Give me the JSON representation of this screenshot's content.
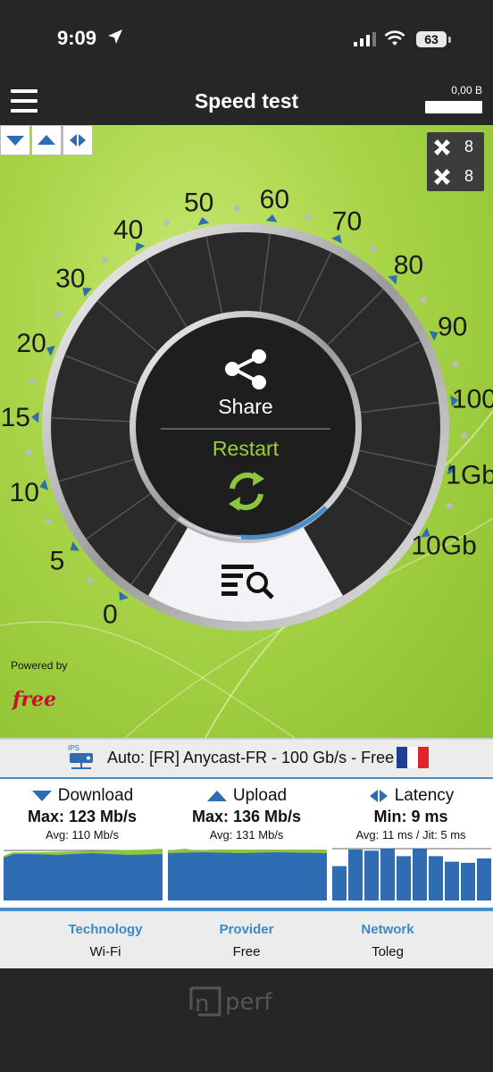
{
  "status_bar": {
    "time": "9:09",
    "battery": "63"
  },
  "app_bar": {
    "title": "Speed test",
    "balance": "0,00 B"
  },
  "servers_panel": {
    "count_a": "8",
    "count_b": "8"
  },
  "gauge": {
    "scale_labels": [
      "0",
      "5",
      "10",
      "15",
      "20",
      "30",
      "40",
      "50",
      "60",
      "70",
      "80",
      "90",
      "100",
      "1Gb",
      "10Gb"
    ],
    "share_label": "Share",
    "restart_label": "Restart"
  },
  "powered_by": {
    "label": "Powered by",
    "logo_text": "free"
  },
  "server": {
    "text": "Auto: [FR] Anycast-FR - 100 Gb/s - Free",
    "icon_text": "IPS",
    "flag_colors": [
      "#1f3f95",
      "#ffffff",
      "#e1242c"
    ]
  },
  "results": {
    "download": {
      "label": "Download",
      "max": "Max: 123 Mb/s",
      "avg": "Avg: 110 Mb/s"
    },
    "upload": {
      "label": "Upload",
      "max": "Max: 136 Mb/s",
      "avg": "Avg: 131 Mb/s"
    },
    "latency": {
      "label": "Latency",
      "min": "Min: 9 ms",
      "avg": "Avg: 11 ms / Jit: 5 ms",
      "bars": [
        0.62,
        0.92,
        0.9,
        0.94,
        0.8,
        0.94,
        0.8,
        0.7,
        0.68,
        0.76
      ]
    }
  },
  "info": {
    "technology": {
      "label": "Technology",
      "value": "Wi-Fi"
    },
    "provider": {
      "label": "Provider",
      "value": "Free"
    },
    "network": {
      "label": "Network",
      "value": "Toleg"
    }
  },
  "footer": {
    "logo_text": "nperf"
  },
  "colors": {
    "accent_blue": "#2e6db4",
    "green": "#8cc63f",
    "dark": "#262626"
  }
}
